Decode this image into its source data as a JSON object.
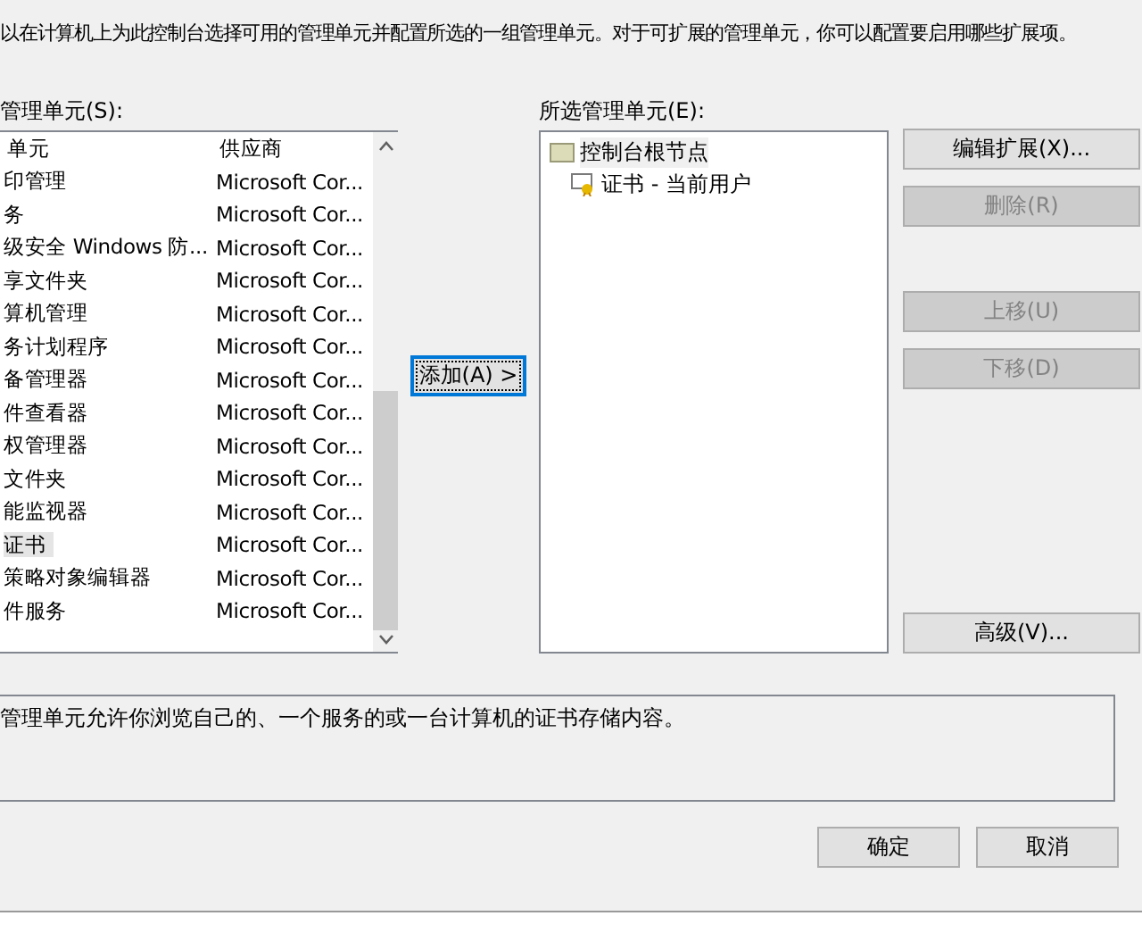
{
  "intro": "以在计算机上为此控制台选择可用的管理单元并配置所选的一组管理单元。对于可扩展的管理单元，你可以配置要启用哪些扩展项。",
  "available": {
    "label": "管理单元(S):",
    "columns": [
      "单元",
      "供应商"
    ],
    "rows": [
      {
        "name": "印管理",
        "vendor": "Microsoft Cor...",
        "selected": false
      },
      {
        "name": "务",
        "vendor": "Microsoft Cor...",
        "selected": false
      },
      {
        "name": "级安全 Windows 防...",
        "vendor": "Microsoft Cor...",
        "selected": false
      },
      {
        "name": "享文件夹",
        "vendor": "Microsoft Cor...",
        "selected": false
      },
      {
        "name": "算机管理",
        "vendor": "Microsoft Cor...",
        "selected": false
      },
      {
        "name": "务计划程序",
        "vendor": "Microsoft Cor...",
        "selected": false
      },
      {
        "name": "备管理器",
        "vendor": "Microsoft Cor...",
        "selected": false
      },
      {
        "name": "件查看器",
        "vendor": "Microsoft Cor...",
        "selected": false
      },
      {
        "name": "权管理器",
        "vendor": "Microsoft Cor...",
        "selected": false
      },
      {
        "name": "文件夹",
        "vendor": "Microsoft Cor...",
        "selected": false
      },
      {
        "name": "能监视器",
        "vendor": "Microsoft Cor...",
        "selected": false
      },
      {
        "name": "证书",
        "vendor": "Microsoft Cor...",
        "selected": true
      },
      {
        "name": "策略对象编辑器",
        "vendor": "Microsoft Cor...",
        "selected": false
      },
      {
        "name": "件服务",
        "vendor": "Microsoft Cor...",
        "selected": false
      }
    ]
  },
  "add_button": "添加(A) >",
  "selected_snapins": {
    "label": "所选管理单元(E):",
    "tree": [
      {
        "label": "控制台根节点",
        "kind": "folder",
        "children": [
          {
            "label": "证书 - 当前用户",
            "kind": "snapin"
          }
        ]
      }
    ]
  },
  "side_buttons": [
    {
      "label": "编辑扩展(X)...",
      "disabled": false
    },
    {
      "label": "删除(R)",
      "disabled": true
    },
    {
      "label": "上移(U)",
      "disabled": true
    },
    {
      "label": "下移(D)",
      "disabled": true
    }
  ],
  "advanced_button": {
    "label": "高级(V)...",
    "disabled": false
  },
  "description": "管理单元允许你浏览自己的、一个服务的或一台计算机的证书存储内容。",
  "footer_buttons": [
    {
      "label": "确定",
      "disabled": false
    },
    {
      "label": "取消",
      "disabled": false
    }
  ]
}
